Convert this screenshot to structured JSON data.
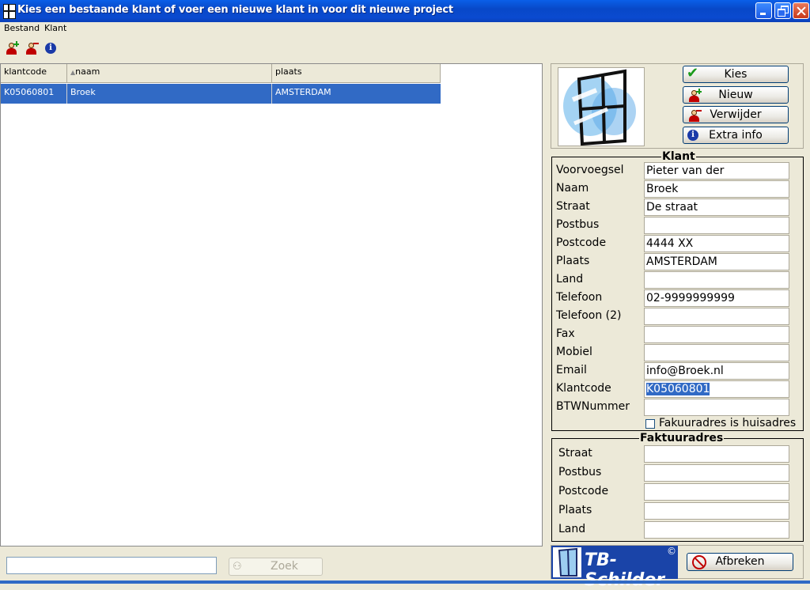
{
  "window": {
    "title": "Kies een bestaande klant of voer een nieuwe klant in voor dit nieuwe project"
  },
  "menu": {
    "items": [
      "Bestand",
      "Klant"
    ]
  },
  "toolbar": {
    "icons": [
      "add-client-icon",
      "remove-client-icon",
      "info-icon"
    ]
  },
  "grid": {
    "columns": [
      "klantcode",
      "naam",
      "plaats"
    ],
    "rows": [
      {
        "klantcode": "K05060801",
        "naam": "Broek",
        "plaats": "AMSTERDAM"
      }
    ]
  },
  "search": {
    "value": "",
    "button": "Zoek"
  },
  "actions": {
    "kies": "Kies",
    "nieuw": "Nieuw",
    "verwijder": "Verwijder",
    "extra_info": "Extra info",
    "afbreken": "Afbreken"
  },
  "klant": {
    "legend": "Klant",
    "fields": [
      {
        "label": "Voorvoegsel",
        "value": "Pieter van der"
      },
      {
        "label": "Naam",
        "value": "Broek"
      },
      {
        "label": "Straat",
        "value": "De straat"
      },
      {
        "label": "Postbus",
        "value": ""
      },
      {
        "label": "Postcode",
        "value": "4444 XX"
      },
      {
        "label": "Plaats",
        "value": "AMSTERDAM"
      },
      {
        "label": "Land",
        "value": ""
      },
      {
        "label": "Telefoon",
        "value": "02-9999999999"
      },
      {
        "label": "Telefoon (2)",
        "value": ""
      },
      {
        "label": "Fax",
        "value": ""
      },
      {
        "label": "Mobiel",
        "value": ""
      },
      {
        "label": "Email",
        "value": "info@Broek.nl"
      },
      {
        "label": "Klantcode",
        "value": "K05060801"
      },
      {
        "label": "BTWNummer",
        "value": ""
      }
    ],
    "checkbox": {
      "label": "Fakuuradres is huisadres",
      "checked": false
    }
  },
  "faktuur": {
    "legend": "Faktuuradres",
    "fields": [
      {
        "label": "Straat",
        "value": ""
      },
      {
        "label": "Postbus",
        "value": ""
      },
      {
        "label": "Postcode",
        "value": ""
      },
      {
        "label": "Plaats",
        "value": ""
      },
      {
        "label": "Land",
        "value": ""
      }
    ]
  },
  "brand": {
    "name": "TB-Schilder",
    "mark": "©"
  }
}
